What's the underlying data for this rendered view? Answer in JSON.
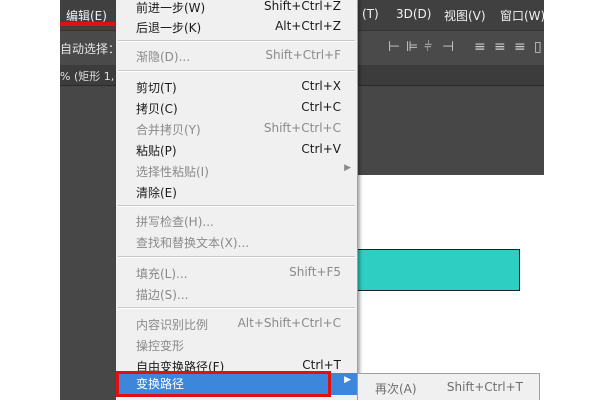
{
  "menubar": {
    "items": [
      "编辑(E)",
      "(T)",
      "3D(D)",
      "视图(V)",
      "窗口(W)"
    ]
  },
  "options": {
    "label": "自动选择："
  },
  "tab": {
    "label": "% (矩形 1,"
  },
  "menu": {
    "items": [
      {
        "label": "前进一步(W)",
        "shortcut": "Shift+Ctrl+Z",
        "enabled": true
      },
      {
        "label": "后退一步(K)",
        "shortcut": "Alt+Ctrl+Z",
        "enabled": true
      },
      {
        "label": "渐隐(D)...",
        "shortcut": "Shift+Ctrl+F",
        "enabled": false
      },
      {
        "label": "剪切(T)",
        "shortcut": "Ctrl+X",
        "enabled": true
      },
      {
        "label": "拷贝(C)",
        "shortcut": "Ctrl+C",
        "enabled": true
      },
      {
        "label": "合并拷贝(Y)",
        "shortcut": "Shift+Ctrl+C",
        "enabled": false
      },
      {
        "label": "粘贴(P)",
        "shortcut": "Ctrl+V",
        "enabled": true
      },
      {
        "label": "选择性粘贴(I)",
        "shortcut": "",
        "enabled": false
      },
      {
        "label": "清除(E)",
        "shortcut": "",
        "enabled": true
      },
      {
        "label": "拼写检查(H)...",
        "shortcut": "",
        "enabled": false
      },
      {
        "label": "查找和替换文本(X)...",
        "shortcut": "",
        "enabled": false
      },
      {
        "label": "填充(L)...",
        "shortcut": "Shift+F5",
        "enabled": false
      },
      {
        "label": "描边(S)...",
        "shortcut": "",
        "enabled": false
      },
      {
        "label": "内容识别比例",
        "shortcut": "Alt+Shift+Ctrl+C",
        "enabled": false
      },
      {
        "label": "操控变形",
        "shortcut": "",
        "enabled": false
      },
      {
        "label": "自由变换路径(F)",
        "shortcut": "Ctrl+T",
        "enabled": true
      },
      {
        "label": "变换路径",
        "shortcut": "",
        "enabled": true
      }
    ]
  },
  "submenu": {
    "label": "再次(A)",
    "shortcut": "Shift+Ctrl+T"
  },
  "colors": {
    "accent": "#3c86dc",
    "highlight_red": "#e01010",
    "teal_shape": "#2ecec3"
  }
}
